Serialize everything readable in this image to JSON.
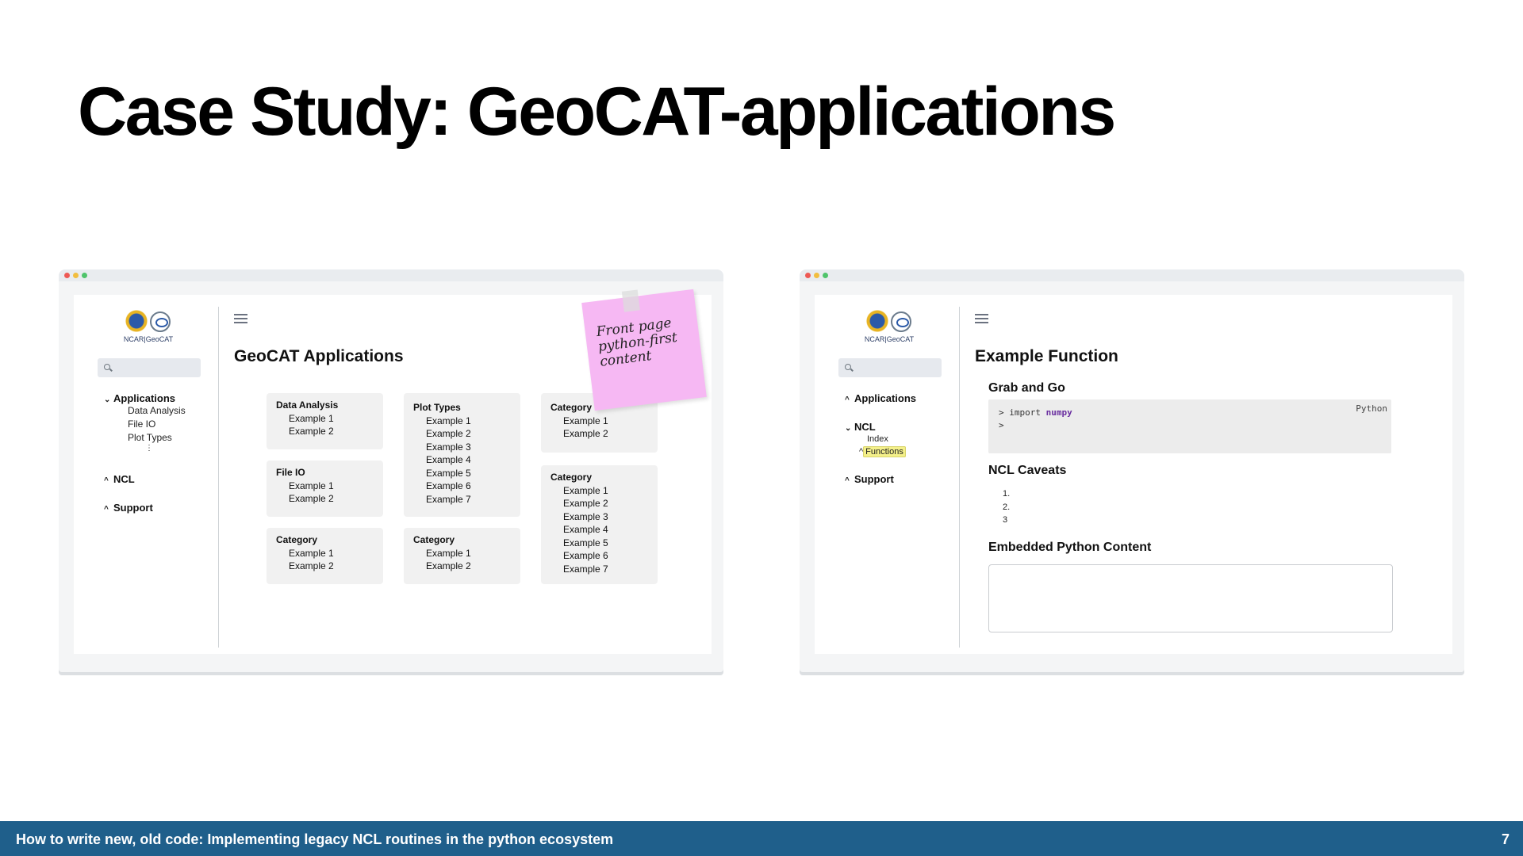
{
  "slide": {
    "title": "Case Study: GeoCAT-applications"
  },
  "left_mockup": {
    "logo_text": "NCAR|GeoCAT",
    "nav": {
      "applications": "Applications",
      "app_items": [
        "Data Analysis",
        "File IO",
        "Plot Types",
        "⋮"
      ],
      "ncl": "NCL",
      "support": "Support"
    },
    "page_title": "GeoCAT Applications",
    "cards": [
      {
        "title": "Data Analysis",
        "items": [
          "Example 1",
          "Example 2"
        ]
      },
      {
        "title": "File IO",
        "items": [
          "Example 1",
          "Example 2"
        ]
      },
      {
        "title": "Category",
        "items": [
          "Example 1",
          "Example 2"
        ]
      },
      {
        "title": "Plot Types",
        "items": [
          "Example 1",
          "Example 2",
          "Example 3",
          "Example 4",
          "Example 5",
          "Example 6",
          "Example 7"
        ]
      },
      {
        "title": "Category",
        "items": [
          "Example 1",
          "Example 2"
        ]
      },
      {
        "title": "Category",
        "items": [
          "Example 1",
          "Example 2"
        ]
      },
      {
        "title": "Category",
        "items": [
          "Example 1",
          "Example 2",
          "Example 3",
          "Example 4",
          "Example 5",
          "Example 6",
          "Example 7"
        ]
      }
    ],
    "sticky_note": [
      "Front page",
      "python-first",
      "content"
    ]
  },
  "right_mockup": {
    "logo_text": "NCAR|GeoCAT",
    "nav": {
      "applications": "Applications",
      "ncl": "NCL",
      "ncl_items": [
        "Index",
        "Functions"
      ],
      "support": "Support"
    },
    "page_title": "Example Function",
    "grab_and_go": "Grab and Go",
    "code": {
      "prompt": ">",
      "text": "import",
      "module": "numpy",
      "prompt2": ">",
      "language": "Python"
    },
    "caveats_title": "NCL Caveats",
    "caveats": [
      "1.",
      "2.",
      "3"
    ],
    "embedded_title": "Embedded Python Content"
  },
  "footer": {
    "text": "How to write new, old code: Implementing legacy NCL routines in the python ecosystem",
    "page_number": "7"
  },
  "colors": {
    "footer_bg": "#1f5f8b",
    "sticky": "#f6b8f3",
    "highlight": "#f4f08a"
  }
}
